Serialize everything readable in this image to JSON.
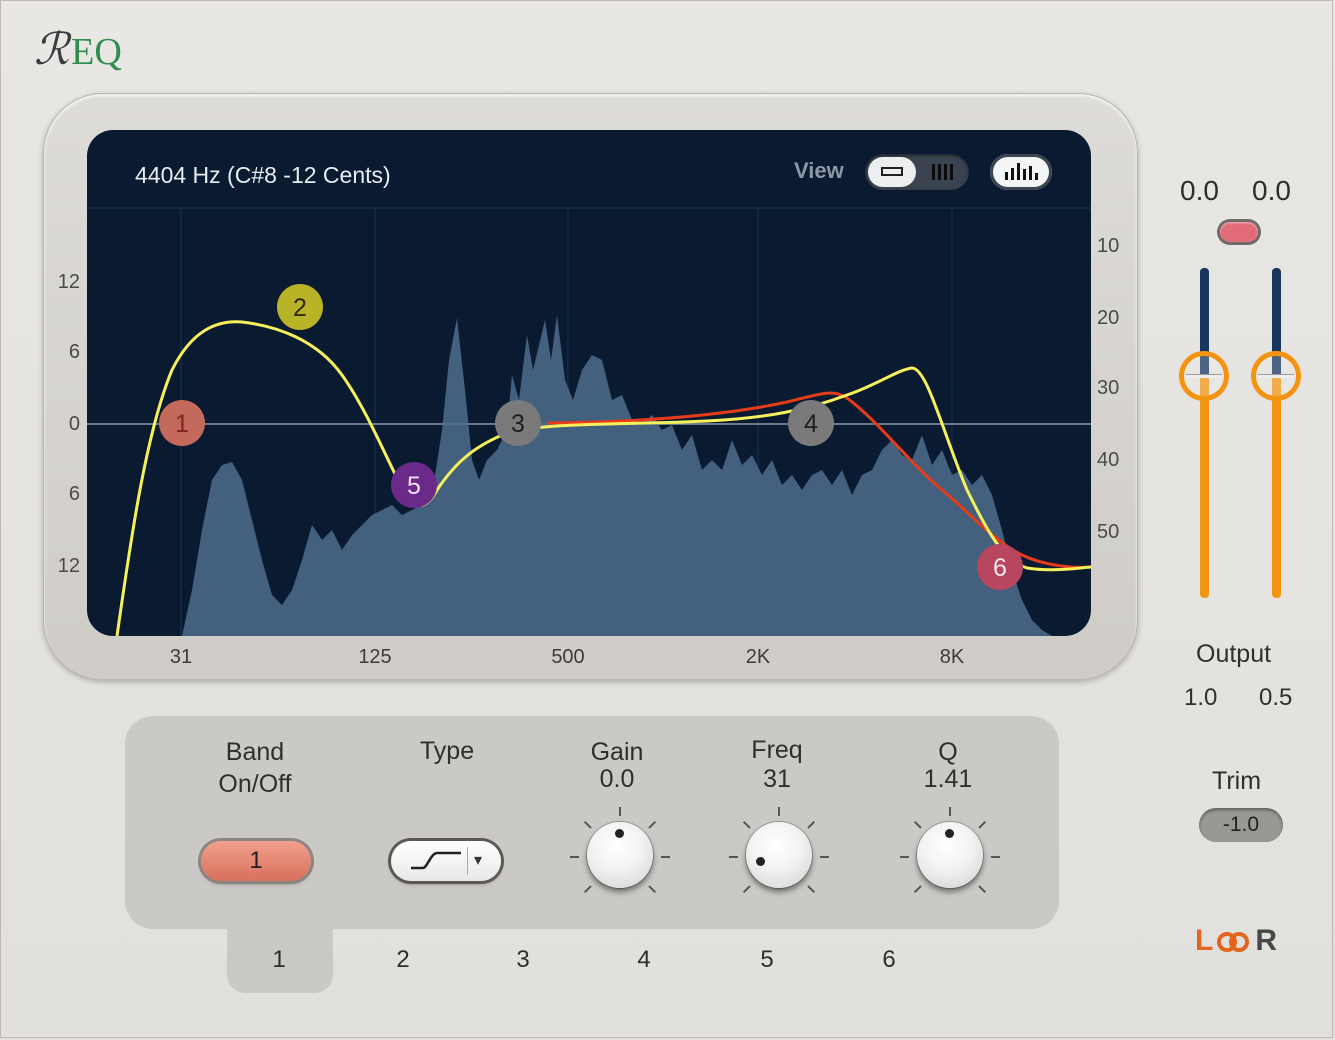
{
  "logo": {
    "r": "ℛ",
    "eq": "EQ"
  },
  "display": {
    "readout": "4404 Hz (C#8 -12 Cents)",
    "view_label": "View",
    "x_ticks": [
      "31",
      "125",
      "500",
      "2K",
      "8K"
    ],
    "gain_ticks": [
      "12",
      "6",
      "0",
      "6",
      "12"
    ],
    "analyzer_ticks": [
      "10",
      "20",
      "30",
      "40",
      "50"
    ],
    "band_nodes": [
      "1",
      "2",
      "3",
      "4",
      "5",
      "6"
    ]
  },
  "controls": {
    "band_onoff_label_1": "Band",
    "band_onoff_label_2": "On/Off",
    "band_button": "1",
    "type_label": "Type",
    "gain_label": "Gain",
    "gain_value": "0.0",
    "freq_label": "Freq",
    "freq_value": "31",
    "q_label": "Q",
    "q_value": "1.41"
  },
  "band_tabs": [
    "1",
    "2",
    "3",
    "4",
    "5",
    "6"
  ],
  "output": {
    "meter_left": "0.0",
    "meter_right": "0.0",
    "label": "Output",
    "value_left": "1.0",
    "value_right": "0.5",
    "trim_label": "Trim",
    "trim_value": "-1.0",
    "link_left": "L",
    "link_right": "R"
  },
  "colors": {
    "eq_curve": "#f6f05a",
    "red_curve": "#e43b1a",
    "spectrum": "#4d6d8c",
    "node1": "#c46a5c",
    "node2": "#b9b328",
    "node3": "#7a7a7a",
    "node4": "#7a7a7a",
    "node5": "#6b2a8a",
    "node6": "#b8465f",
    "fader_accent": "#f29411",
    "brand_green": "#2f8d4e"
  }
}
